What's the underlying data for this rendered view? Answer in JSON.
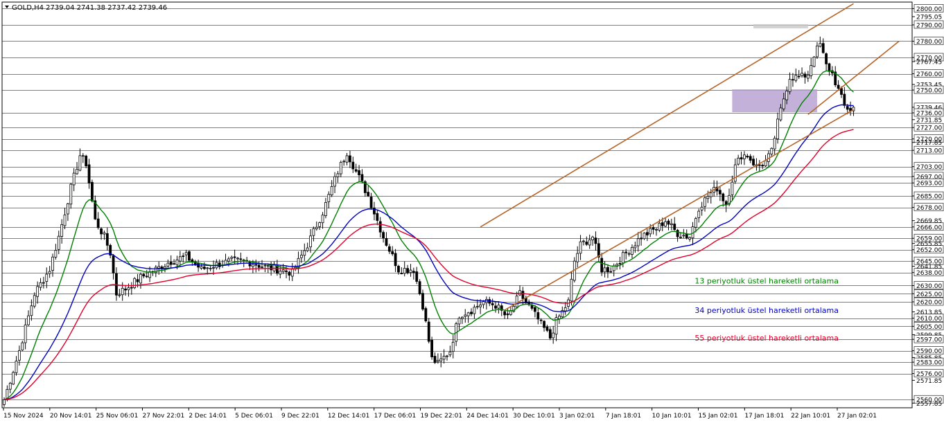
{
  "chart_data": {
    "type": "candlestick",
    "symbol": "GOLD,H4",
    "ohlc_header": {
      "open": "2739.04",
      "high": "2741.38",
      "low": "2737.42",
      "close": "2739.46"
    },
    "title_text": "GOLD,H4  2739.04 2741.38 2737.42 2739.46",
    "ylim": [
      2555,
      2804
    ],
    "last_price": 2739.46,
    "x_labels": [
      "15 Nov 2024",
      "20 Nov 14:01",
      "25 Nov 06:01",
      "27 Nov 22:01",
      "2 Dec 14:01",
      "5 Dec 06:01",
      "9 Dec 22:01",
      "12 Dec 14:01",
      "17 Dec 06:01",
      "19 Dec 22:01",
      "24 Dec 14:01",
      "30 Dec 10:01",
      "3 Jan 02:01",
      "7 Jan 18:01",
      "10 Jan 10:01",
      "15 Jan 02:01",
      "17 Jan 18:01",
      "22 Jan 10:01",
      "27 Jan 02:01"
    ],
    "horizontal_levels": [
      2800,
      2790,
      2780,
      2770,
      2760,
      2750,
      2736,
      2727,
      2720,
      2713,
      2703,
      2697,
      2693,
      2685,
      2678,
      2666,
      2659,
      2652,
      2645,
      2638,
      2630,
      2625,
      2620,
      2610,
      2605,
      2597,
      2590,
      2583,
      2576,
      2560
    ],
    "y_axis_ticks": [
      {
        "v": 2800,
        "t": "2800.00",
        "boxed": true
      },
      {
        "v": 2795.05,
        "t": "2795.05",
        "boxed": false
      },
      {
        "v": 2790,
        "t": "2790.00",
        "boxed": true
      },
      {
        "v": 2780,
        "t": "2780.00",
        "boxed": true
      },
      {
        "v": 2770,
        "t": "2770.00",
        "boxed": true
      },
      {
        "v": 2767.45,
        "t": "2767.45",
        "boxed": false
      },
      {
        "v": 2760,
        "t": "2760.00",
        "boxed": true
      },
      {
        "v": 2753.45,
        "t": "2753.45",
        "boxed": false
      },
      {
        "v": 2750,
        "t": "2750.00",
        "boxed": true
      },
      {
        "v": 2739.46,
        "t": "2739.46",
        "boxed": true
      },
      {
        "v": 2736,
        "t": "2736.00",
        "boxed": true
      },
      {
        "v": 2731.85,
        "t": "2731.85",
        "boxed": false
      },
      {
        "v": 2727,
        "t": "2727.00",
        "boxed": true
      },
      {
        "v": 2720,
        "t": "2720.00",
        "boxed": true
      },
      {
        "v": 2717.85,
        "t": "2717.85",
        "boxed": false
      },
      {
        "v": 2713,
        "t": "2713.00",
        "boxed": true
      },
      {
        "v": 2703,
        "t": "2703.00",
        "boxed": true
      },
      {
        "v": 2697,
        "t": "2697.00",
        "boxed": true
      },
      {
        "v": 2693,
        "t": "2693.00",
        "boxed": true
      },
      {
        "v": 2685,
        "t": "2685.00",
        "boxed": true
      },
      {
        "v": 2678,
        "t": "2678.00",
        "boxed": true
      },
      {
        "v": 2669.85,
        "t": "2669.85",
        "boxed": false
      },
      {
        "v": 2666,
        "t": "2666.00",
        "boxed": true
      },
      {
        "v": 2659,
        "t": "2659.00",
        "boxed": true
      },
      {
        "v": 2655.85,
        "t": "2655.85",
        "boxed": false
      },
      {
        "v": 2652,
        "t": "2652.00",
        "boxed": true
      },
      {
        "v": 2645,
        "t": "2645.00",
        "boxed": true
      },
      {
        "v": 2641.85,
        "t": "2641.85",
        "boxed": false
      },
      {
        "v": 2638,
        "t": "2638.00",
        "boxed": true
      },
      {
        "v": 2630,
        "t": "2630.00",
        "boxed": true
      },
      {
        "v": 2625,
        "t": "2625.00",
        "boxed": true
      },
      {
        "v": 2620,
        "t": "2620.00",
        "boxed": true
      },
      {
        "v": 2613.85,
        "t": "2613.85",
        "boxed": false
      },
      {
        "v": 2610,
        "t": "2610.00",
        "boxed": true
      },
      {
        "v": 2605,
        "t": "2605.00",
        "boxed": true
      },
      {
        "v": 2599.85,
        "t": "2599.85",
        "boxed": false
      },
      {
        "v": 2597,
        "t": "2597.00",
        "boxed": true
      },
      {
        "v": 2590,
        "t": "2590.00",
        "boxed": true
      },
      {
        "v": 2585.85,
        "t": "2585.85",
        "boxed": false
      },
      {
        "v": 2583,
        "t": "2583.00",
        "boxed": true
      },
      {
        "v": 2576,
        "t": "2576.00",
        "boxed": true
      },
      {
        "v": 2571.85,
        "t": "2571.85",
        "boxed": false
      },
      {
        "v": 2560,
        "t": "2560.00",
        "boxed": true
      },
      {
        "v": 2557.85,
        "t": "2557.85",
        "boxed": false
      }
    ],
    "close_path": [
      [
        0,
        2560
      ],
      [
        5,
        2590
      ],
      [
        10,
        2625
      ],
      [
        15,
        2640
      ],
      [
        18,
        2660
      ],
      [
        22,
        2690
      ],
      [
        25,
        2710
      ],
      [
        27,
        2705
      ],
      [
        30,
        2670
      ],
      [
        33,
        2660
      ],
      [
        35,
        2650
      ],
      [
        37,
        2625
      ],
      [
        40,
        2628
      ],
      [
        45,
        2635
      ],
      [
        50,
        2640
      ],
      [
        55,
        2645
      ],
      [
        60,
        2648
      ],
      [
        65,
        2640
      ],
      [
        70,
        2643
      ],
      [
        75,
        2645
      ],
      [
        80,
        2645
      ],
      [
        85,
        2642
      ],
      [
        90,
        2640
      ],
      [
        95,
        2638
      ],
      [
        100,
        2655
      ],
      [
        105,
        2675
      ],
      [
        110,
        2700
      ],
      [
        113,
        2712
      ],
      [
        116,
        2700
      ],
      [
        120,
        2685
      ],
      [
        123,
        2670
      ],
      [
        125,
        2660
      ],
      [
        130,
        2640
      ],
      [
        135,
        2640
      ],
      [
        138,
        2618
      ],
      [
        141,
        2585
      ],
      [
        143,
        2582
      ],
      [
        147,
        2590
      ],
      [
        150,
        2612
      ],
      [
        154,
        2615
      ],
      [
        158,
        2620
      ],
      [
        162,
        2618
      ],
      [
        166,
        2610
      ],
      [
        170,
        2625
      ],
      [
        175,
        2612
      ],
      [
        180,
        2598
      ],
      [
        182,
        2608
      ],
      [
        186,
        2620
      ],
      [
        188,
        2645
      ],
      [
        190,
        2655
      ],
      [
        194,
        2660
      ],
      [
        197,
        2640
      ],
      [
        200,
        2640
      ],
      [
        205,
        2650
      ],
      [
        210,
        2660
      ],
      [
        215,
        2665
      ],
      [
        218,
        2670
      ],
      [
        222,
        2662
      ],
      [
        226,
        2660
      ],
      [
        229,
        2678
      ],
      [
        232,
        2685
      ],
      [
        235,
        2690
      ],
      [
        238,
        2680
      ],
      [
        241,
        2703
      ],
      [
        243,
        2710
      ],
      [
        245,
        2710
      ],
      [
        248,
        2703
      ],
      [
        251,
        2706
      ],
      [
        253,
        2712
      ],
      [
        255,
        2730
      ],
      [
        257,
        2745
      ],
      [
        259,
        2758
      ],
      [
        261,
        2758
      ],
      [
        263,
        2758
      ],
      [
        265,
        2760
      ],
      [
        267,
        2772
      ],
      [
        269,
        2778
      ],
      [
        271,
        2765
      ],
      [
        273,
        2760
      ],
      [
        275,
        2750
      ],
      [
        277,
        2740
      ],
      [
        279,
        2738
      ],
      [
        280,
        2739.46
      ]
    ],
    "ema_lines": [
      {
        "name": "13 periyotluk üstel hareketli ortalama",
        "period": 13,
        "color": "#008000"
      },
      {
        "name": "34 periyotluk üstel hareketli ortalama",
        "period": 34,
        "color": "#0000c0"
      },
      {
        "name": "55 periyotluk üstel hareketli ortalama",
        "period": 55,
        "color": "#e0002a"
      }
    ],
    "channel": {
      "color": "#b5652a",
      "lines": [
        {
          "from": {
            "bar": 157,
            "price": 2666
          },
          "to": {
            "bar": 280,
            "price": 2803
          }
        },
        {
          "from": {
            "bar": 165,
            "price": 2615
          },
          "to": {
            "bar": 280,
            "price": 2738
          }
        },
        {
          "from": {
            "bar": 265,
            "price": 2735
          },
          "to": {
            "bar": 295,
            "price": 2780
          }
        }
      ]
    },
    "zones": [
      {
        "name": "resistance-zone",
        "color": "#c8c8c8",
        "from_bar": 247,
        "to_bar": 265,
        "from_price": 2790,
        "to_price": 2788
      },
      {
        "name": "support-zone",
        "color": "#b59ecf",
        "from_bar": 240,
        "to_bar": 268,
        "from_price": 2750,
        "to_price": 2736
      }
    ],
    "annotations": [
      {
        "text": "13 periyotluk üstel hareketli ortalama",
        "color": "#008000",
        "price": 2633
      },
      {
        "text": "34 periyotluk üstel hareketli ortalama",
        "color": "#0000c0",
        "price": 2615
      },
      {
        "text": "55 periyotluk üstel hareketli ortalama",
        "color": "#e0002a",
        "price": 2598
      }
    ]
  }
}
